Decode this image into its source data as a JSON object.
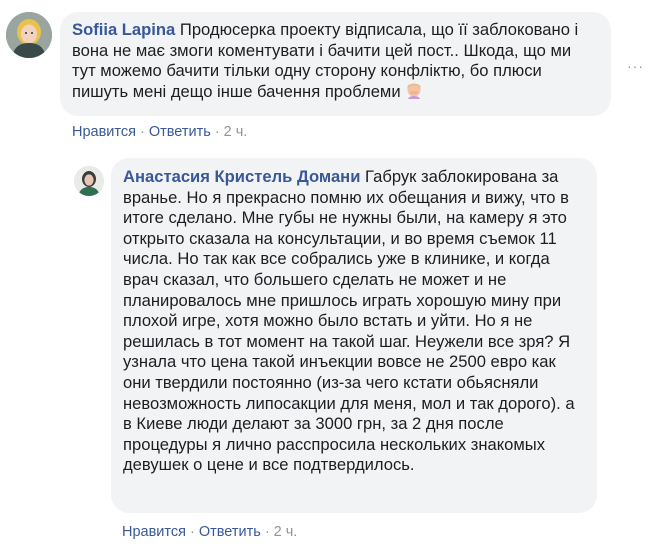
{
  "comments": [
    {
      "author": "Sofiia Lapina",
      "text": "Продюсерка проекту відписала, що її заблоковано і вона не має змоги коментувати і бачити цей пост.. Шкода, що ми тут можемо бачити тільки одну сторону конфліктю, бо плюси пишуть мені дещо інше бачення проблеми",
      "emoji": "woman-facepalming-emoji",
      "like_label": "Нравится",
      "reply_label": "Ответить",
      "time": "2 ч.",
      "more_label": "···"
    },
    {
      "author": "Анастасия Кристель Домани",
      "text": "Габрук заблокирована за вранье. Но я прекрасно помню их обещания и вижу, что в итоге сделано. Мне губы не нужны были, на камеру я это открыто сказала на консультации, и во время съемок 11 числа. Но так как все собрались уже в клинике, и когда врач сказал, что большего сделать не может и не планировалось мне пришлось играть хорошую мину при плохой игре, хотя можно было встать и уйти. Но я не решилась в тот момент на такой шаг. Неужели все зря? Я узнала что цена такой инъекции вовсе не 2500 евро как они твердили постоянно (из-за чего кстати обьясняли невозможность липосакции для меня, мол и так дорого). а в Киеве люди делают за 3000 грн, за 2 дня после процедуры я лично расспросила нескольких знакомых девушек о цене и все подтвердилось.",
      "like_label": "Нравится",
      "reply_label": "Ответить",
      "time": "2 ч."
    }
  ],
  "colors": {
    "author": "#385898",
    "bubble": "#f2f3f5",
    "meta": "#90949c"
  }
}
